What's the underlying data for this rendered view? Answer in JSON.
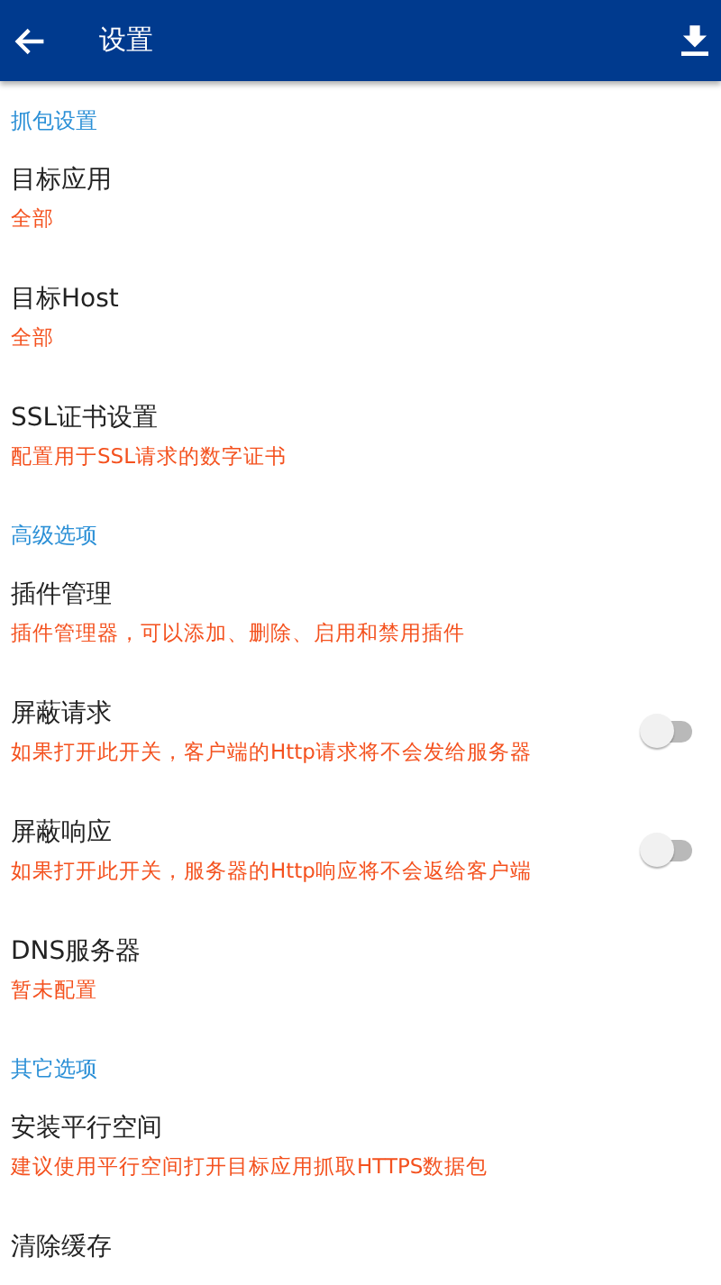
{
  "app_bar": {
    "title": "设置"
  },
  "sections": [
    {
      "header": "抓包设置",
      "items": [
        {
          "kind": "text",
          "title": "目标应用",
          "summary": "全部"
        },
        {
          "kind": "text",
          "title": "目标Host",
          "summary": "全部"
        },
        {
          "kind": "text",
          "title": "SSL证书设置",
          "summary": "配置用于SSL请求的数字证书"
        }
      ]
    },
    {
      "header": "高级选项",
      "items": [
        {
          "kind": "text",
          "title": "插件管理",
          "summary": "插件管理器，可以添加、删除、启用和禁用插件"
        },
        {
          "kind": "switch",
          "title": "屏蔽请求",
          "summary": "如果打开此开关，客户端的Http请求将不会发给服务器",
          "on": false
        },
        {
          "kind": "switch",
          "title": "屏蔽响应",
          "summary": "如果打开此开关，服务器的Http响应将不会返给客户端",
          "on": false
        },
        {
          "kind": "text",
          "title": "DNS服务器",
          "summary": "暂未配置"
        }
      ]
    },
    {
      "header": "其它选项",
      "items": [
        {
          "kind": "text",
          "title": "安装平行空间",
          "summary": "建议使用平行空间打开目标应用抓取HTTPS数据包"
        },
        {
          "kind": "text",
          "title": "清除缓存"
        }
      ]
    }
  ]
}
